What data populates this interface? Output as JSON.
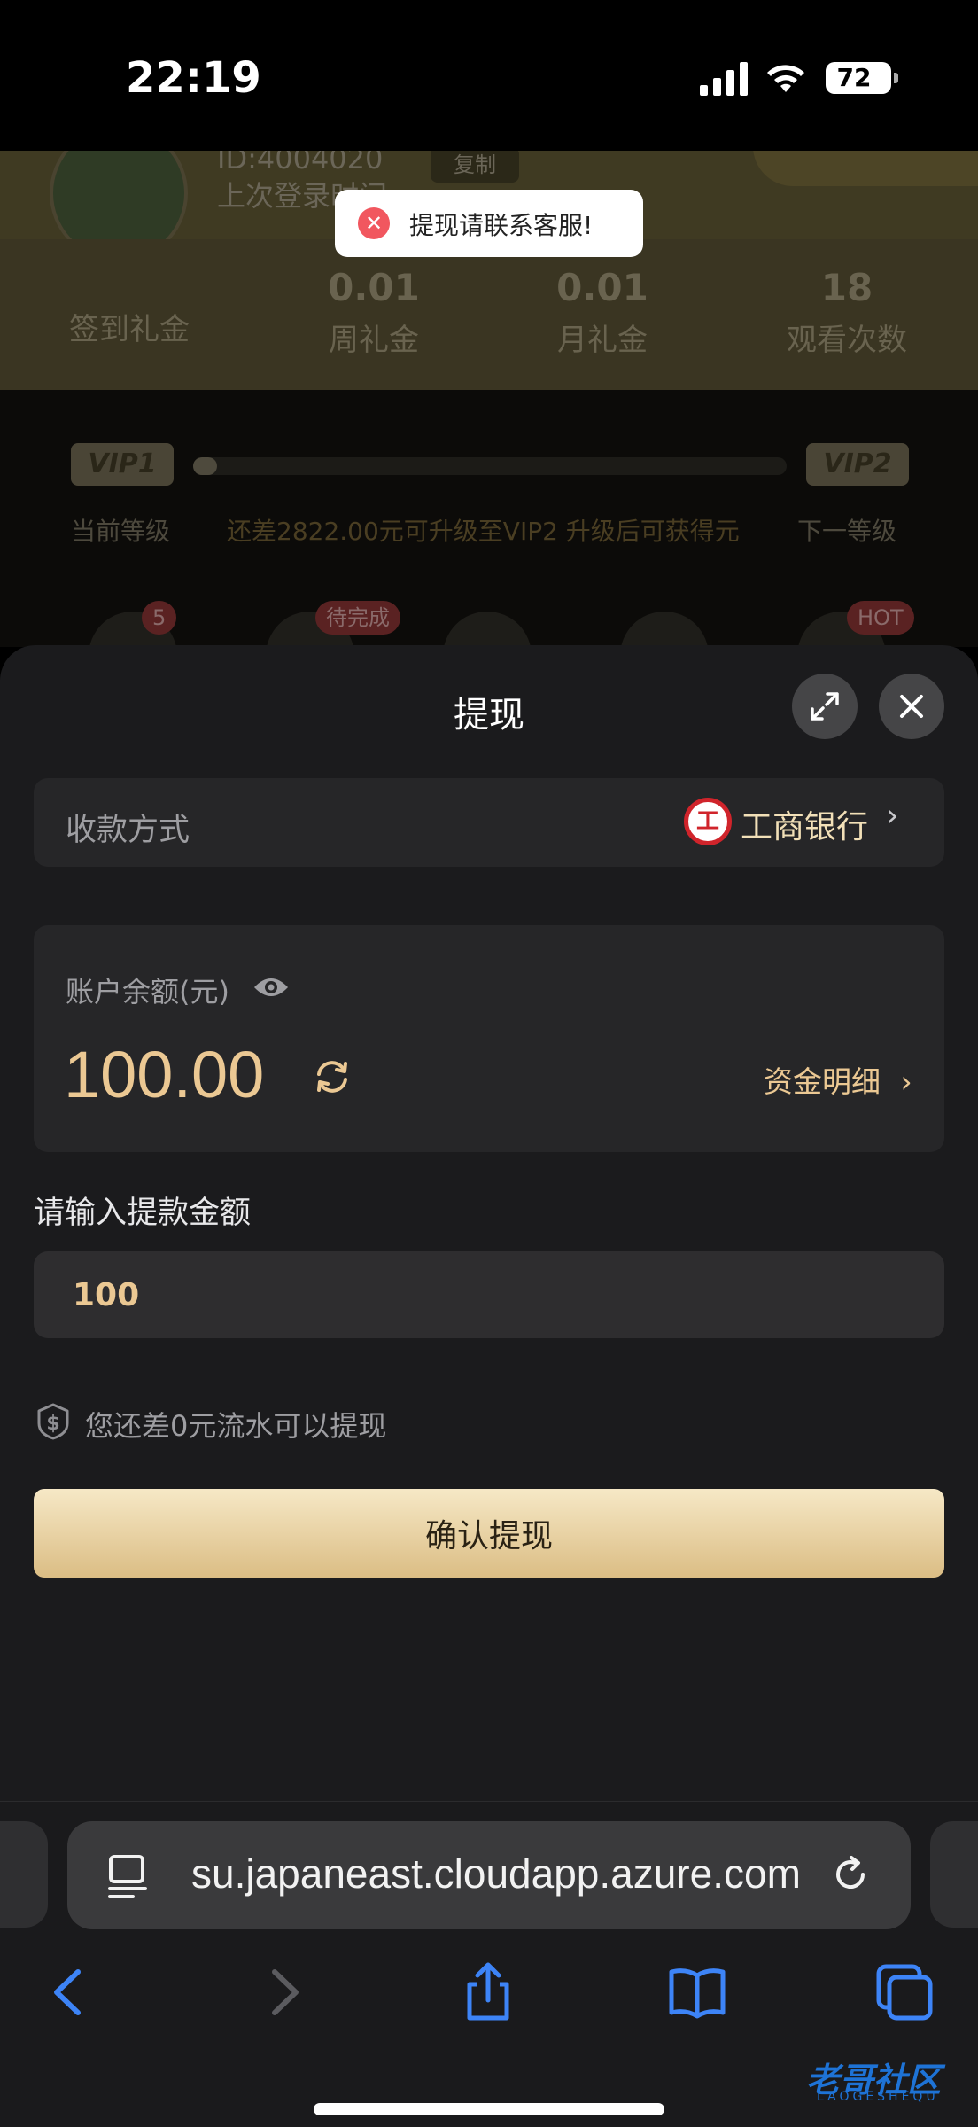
{
  "status_bar": {
    "time": "22:19",
    "battery": "72"
  },
  "background_page": {
    "id_text": "ID:4004020",
    "copy_label": "复制",
    "last_login": "上次登录时间:",
    "stats": [
      {
        "value": "",
        "label": "签到礼金"
      },
      {
        "value": "0.01",
        "label": "周礼金"
      },
      {
        "value": "0.01",
        "label": "月礼金"
      },
      {
        "value": "18",
        "label": "观看次数"
      }
    ],
    "vip": {
      "current_badge": "VIP1",
      "next_badge": "VIP2",
      "current_label": "当前等级",
      "next_label": "下一等级",
      "progress_text": "还差2822.00元可升级至VIP2 升级后可获得元",
      "progress": 0.04
    },
    "icon_badges": {
      "count": "5",
      "pending": "待完成",
      "hot": "HOT"
    }
  },
  "toast": {
    "text": "提现请联系客服!"
  },
  "withdraw_sheet": {
    "title": "提现",
    "payment_method_label": "收款方式",
    "bank_name": "工商银行",
    "balance_label": "账户余额(元)",
    "balance_amount": "100.00",
    "detail_link": "资金明细",
    "amount_label": "请输入提款金额",
    "amount_value": "100",
    "turnover_hint": "您还差0元流水可以提现",
    "confirm_label": "确认提现"
  },
  "browser": {
    "url": "su.japaneast.cloudapp.azure.com"
  },
  "watermark": {
    "text": "老哥社区",
    "sub": "LAOGESHEQU"
  },
  "colors": {
    "gold": "#ebc893",
    "sheet_bg": "#1b1b1d",
    "card_bg": "#262628",
    "toast_error": "#f1575f",
    "ios_blue": "#3d84f7"
  }
}
